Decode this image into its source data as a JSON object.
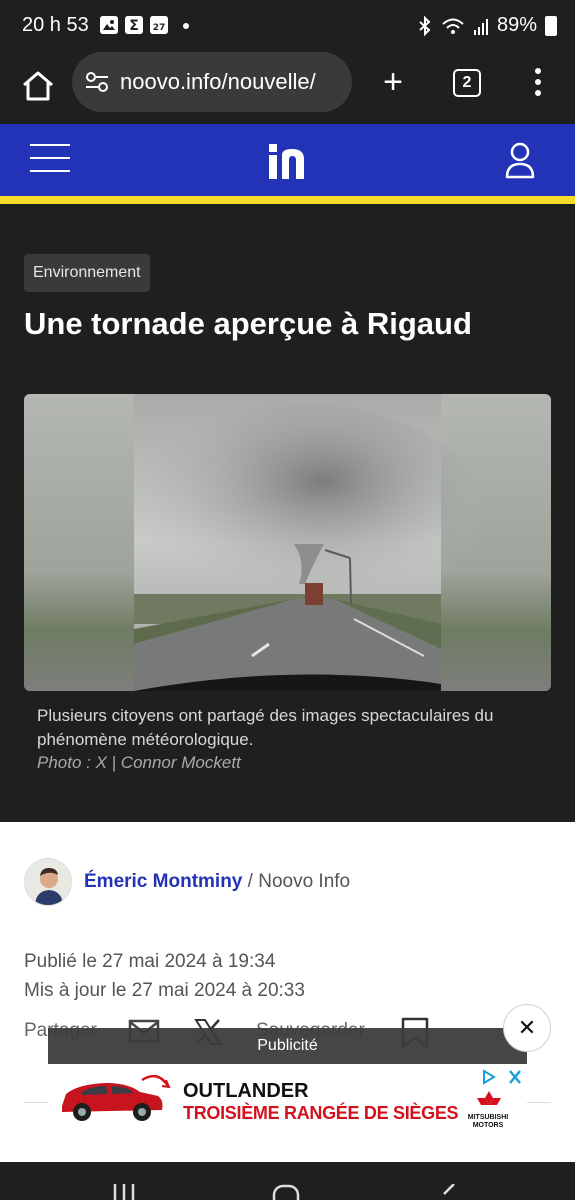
{
  "status_bar": {
    "time": "20 h 53",
    "notification_icons": [
      "gallery-icon",
      "sigma-app-icon",
      "calendar-icon"
    ],
    "calendar_day": "27",
    "battery": "89%"
  },
  "browser": {
    "url": "noovo.info/nouvelle/",
    "tab_count": "2"
  },
  "site": {
    "brand_color": "#2233b8",
    "accent_color": "#f5dc2a"
  },
  "article": {
    "category": "Environnement",
    "title": "Une tornade aperçue à Rigaud",
    "caption": "Plusieurs citoyens ont partagé des images spectaculaires du phénomène météorologique.",
    "photo_credit": "Photo : X | Connor Mockett",
    "author": "Émeric Montminy",
    "author_sep": " / ",
    "outlet": "Noovo Info",
    "published": "Publié le 27 mai 2024 à 19:34",
    "updated": "Mis à jour le 27 mai 2024 à 20:33",
    "share_label": "Partager",
    "save_label": "Sauvegarder"
  },
  "ad": {
    "label": "Publicité",
    "close": "✕",
    "headline": "OUTLANDER",
    "subline": "TROISIÈME RANGÉE DE SIÈGES",
    "brand": "MITSUBISHI MOTORS"
  }
}
